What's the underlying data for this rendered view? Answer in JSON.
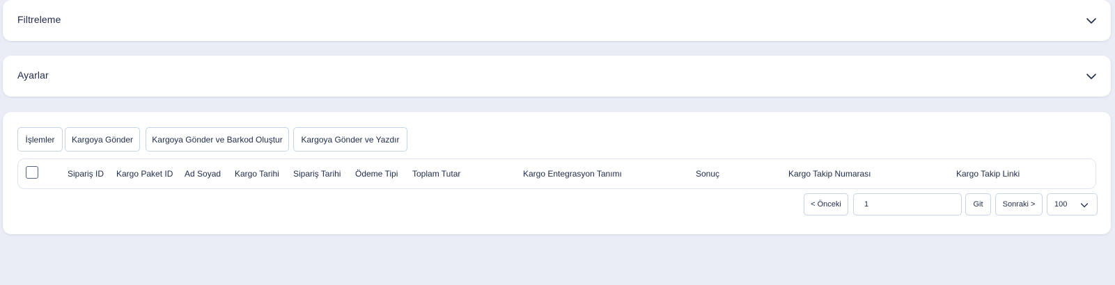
{
  "filter_panel": {
    "title": "Filtreleme"
  },
  "settings_panel": {
    "title": "Ayarlar"
  },
  "actions": {
    "islemler": "İşlemler",
    "kargoya_gonder": "Kargoya Gönder",
    "kargoya_gonder_barkod": "Kargoya Gönder ve Barkod Oluştur",
    "kargoya_gonder_yazdir": "Kargoya Gönder ve Yazdır"
  },
  "table": {
    "columns": [
      "Sipariş ID",
      "Kargo Paket ID",
      "Ad Soyad",
      "Kargo Tarihi",
      "Sipariş Tarihi",
      "Ödeme Tipi",
      "Toplam Tutar",
      "Kargo Entegrasyon Tanımı",
      "Sonuç",
      "Kargo Takip Numarası",
      "Kargo Takip Linki"
    ]
  },
  "pagination": {
    "prev_label": "< Önceki",
    "page_value": "1",
    "go_label": "Git",
    "next_label": "Sonraki >",
    "page_size": "100"
  },
  "icons": {
    "collapse": "chevron-down-icon",
    "select": "chevron-down-icon"
  },
  "colors": {
    "background": "#eaedf5",
    "card": "#ffffff",
    "text": "#1e2a4a",
    "border": "#c8d3e8"
  }
}
